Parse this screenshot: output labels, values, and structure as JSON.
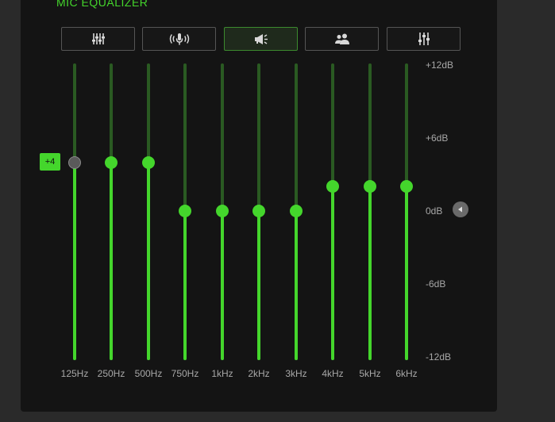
{
  "title": "MIC EQUALIZER",
  "presets": [
    {
      "icon": "sliders-icon",
      "active": false
    },
    {
      "icon": "microphone-broadcast-icon",
      "active": false
    },
    {
      "icon": "megaphone-icon",
      "active": true
    },
    {
      "icon": "people-icon",
      "active": false
    },
    {
      "icon": "custom-sliders-icon",
      "active": false
    }
  ],
  "db_labels": [
    "+12dB",
    "+6dB",
    "0dB",
    "-6dB",
    "-12dB"
  ],
  "range_db": [
    -12,
    12
  ],
  "bands": [
    {
      "freq": "125Hz",
      "gain_db": 4
    },
    {
      "freq": "250Hz",
      "gain_db": 4
    },
    {
      "freq": "500Hz",
      "gain_db": 4
    },
    {
      "freq": "750Hz",
      "gain_db": 0
    },
    {
      "freq": "1kHz",
      "gain_db": 0
    },
    {
      "freq": "2kHz",
      "gain_db": 0
    },
    {
      "freq": "3kHz",
      "gain_db": 0
    },
    {
      "freq": "4kHz",
      "gain_db": 2
    },
    {
      "freq": "5kHz",
      "gain_db": 2
    },
    {
      "freq": "6kHz",
      "gain_db": 2
    }
  ],
  "selected_band_index": 0,
  "selected_value_label": "+4",
  "colors": {
    "accent": "#44d62c",
    "track": "#2a5a22",
    "panel": "#141414",
    "text": "#a8a8a8"
  }
}
